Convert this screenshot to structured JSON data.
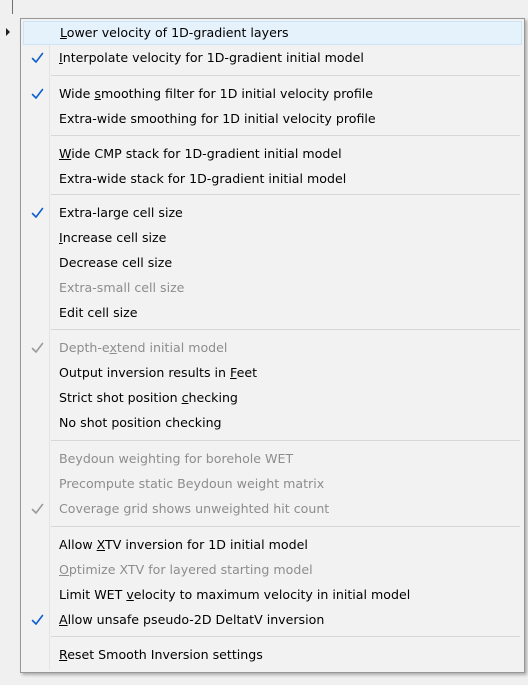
{
  "colors": {
    "check_enabled": "#0d5fcf",
    "check_disabled": "#9a9a9a",
    "highlight": "#e5f1fb"
  },
  "menu": {
    "items": [
      {
        "label": "Lower velocity of 1D-gradient layers",
        "pre": "",
        "u": "L",
        "post": "ower velocity of 1D-gradient layers",
        "checked": false,
        "disabled": false,
        "highlighted": true
      },
      {
        "label": "Interpolate velocity for 1D-gradient initial model",
        "pre": "",
        "u": "I",
        "post": "nterpolate velocity for 1D-gradient initial model",
        "checked": true,
        "disabled": false
      },
      {
        "label": "Wide smoothing filter for 1D initial velocity profile",
        "pre": "Wide ",
        "u": "s",
        "post": "moothing filter for 1D initial velocity profile",
        "checked": true,
        "disabled": false
      },
      {
        "label": "Extra-wide smoothing for 1D initial velocity profile",
        "pre": "Extra-wide smoothing for 1D initial velocity profile",
        "u": "",
        "post": "",
        "checked": false,
        "disabled": false
      },
      {
        "label": "Wide CMP stack for 1D-gradient initial model",
        "pre": "",
        "u": "W",
        "post": "ide CMP stack for 1D-gradient initial model",
        "checked": false,
        "disabled": false
      },
      {
        "label": "Extra-wide stack for 1D-gradient initial model",
        "pre": "Extra-wide stack for 1D-gradient initial model",
        "u": "",
        "post": "",
        "checked": false,
        "disabled": false
      },
      {
        "label": "Extra-large cell size",
        "pre": "Extra-large cell size",
        "u": "",
        "post": "",
        "checked": true,
        "disabled": false
      },
      {
        "label": "Increase cell size",
        "pre": "",
        "u": "I",
        "post": "ncrease cell size",
        "checked": false,
        "disabled": false
      },
      {
        "label": "Decrease cell size",
        "pre": "Decrease cell size",
        "u": "",
        "post": "",
        "checked": false,
        "disabled": false
      },
      {
        "label": "Extra-small cell size",
        "pre": "Extra-small cell size",
        "u": "",
        "post": "",
        "checked": false,
        "disabled": true
      },
      {
        "label": "Edit cell size",
        "pre": "Edit cell size",
        "u": "",
        "post": "",
        "checked": false,
        "disabled": false
      },
      {
        "label": "Depth-extend initial model",
        "pre": "Depth-e",
        "u": "x",
        "post": "tend initial model",
        "checked": true,
        "disabled": true
      },
      {
        "label": "Output inversion results in Feet",
        "pre": "Output inversion results in ",
        "u": "F",
        "post": "eet",
        "checked": false,
        "disabled": false
      },
      {
        "label": "Strict shot position checking",
        "pre": "Strict shot position ",
        "u": "c",
        "post": "hecking",
        "checked": false,
        "disabled": false
      },
      {
        "label": "No shot position checking",
        "pre": "No shot position checking",
        "u": "",
        "post": "",
        "checked": false,
        "disabled": false
      },
      {
        "label": "Beydoun weighting for borehole WET",
        "pre": "Beydoun weighting for borehole WET",
        "u": "",
        "post": "",
        "checked": false,
        "disabled": true
      },
      {
        "label": "Precompute static Beydoun weight matrix",
        "pre": "Precompute static Beydoun weight matrix",
        "u": "",
        "post": "",
        "checked": false,
        "disabled": true
      },
      {
        "label": "Coverage grid shows unweighted hit count",
        "pre": "Coverage grid shows unweighted hit count",
        "u": "",
        "post": "",
        "checked": true,
        "disabled": true
      },
      {
        "label": "Allow XTV inversion for 1D initial model",
        "pre": "Allow ",
        "u": "X",
        "post": "TV inversion for 1D initial model",
        "checked": false,
        "disabled": false
      },
      {
        "label": "Optimize XTV for layered starting model",
        "pre": "",
        "u": "O",
        "post": "ptimize XTV for layered starting model",
        "checked": false,
        "disabled": true
      },
      {
        "label": "Limit WET velocity to maximum velocity in initial model",
        "pre": "Limit WET ",
        "u": "v",
        "post": "elocity to maximum velocity in initial model",
        "checked": false,
        "disabled": false
      },
      {
        "label": "Allow unsafe pseudo-2D DeltatV inversion",
        "pre": "",
        "u": "A",
        "post": "llow unsafe pseudo-2D DeltatV inversion",
        "checked": true,
        "disabled": false
      },
      {
        "label": "Reset Smooth Inversion settings",
        "pre": "",
        "u": "R",
        "post": "eset Smooth Inversion settings",
        "checked": false,
        "disabled": false
      }
    ]
  }
}
